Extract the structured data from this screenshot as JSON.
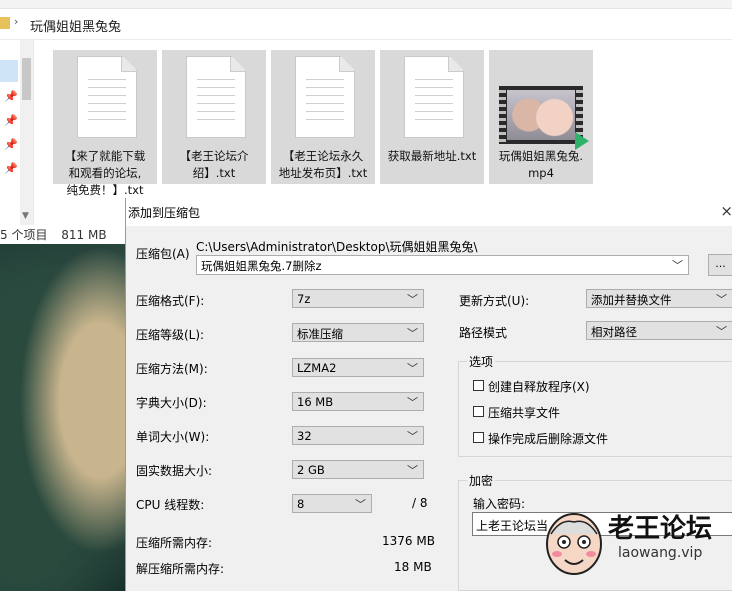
{
  "explorer": {
    "breadcrumb_chevron": "›",
    "current_folder": "玩偶姐姐黑兔兔",
    "status_count": "5 个项目",
    "status_size": "811 MB",
    "files": [
      {
        "name": "【来了就能下载\n和观看的论坛,\n纯免费！】.txt",
        "icon": "text-file-icon"
      },
      {
        "name": "【老王论坛介\n绍】.txt",
        "icon": "text-file-icon"
      },
      {
        "name": "【老王论坛永久\n地址发布页】.txt",
        "icon": "text-file-icon"
      },
      {
        "name": "获取最新地址.txt",
        "icon": "text-file-icon"
      },
      {
        "name": "玩偶姐姐黑兔兔.\nmp4",
        "icon": "video-thumbnail"
      }
    ]
  },
  "dialog": {
    "title": "添加到压缩包",
    "close_glyph": "×",
    "archive_label": "压缩包(A)",
    "archive_dir": "C:\\Users\\Administrator\\Desktop\\玩偶姐姐黑兔兔\\",
    "archive_name": "玩偶姐姐黑兔兔.7删除z",
    "browse_label": "...",
    "format_label": "压缩格式(F):",
    "format_value": "7z",
    "level_label": "压缩等级(L):",
    "level_value": "标准压缩",
    "method_label": "压缩方法(M):",
    "method_value": "LZMA2",
    "dict_label": "字典大小(D):",
    "dict_value": "16 MB",
    "word_label": "单词大小(W):",
    "word_value": "32",
    "solid_label": "固实数据大小:",
    "solid_value": "2 GB",
    "cpu_label": "CPU 线程数:",
    "cpu_value": "8",
    "cpu_max": "/ 8",
    "mem_compress_label": "压缩所需内存:",
    "mem_compress_value": "1376 MB",
    "mem_decompress_label": "解压缩所需内存:",
    "mem_decompress_value": "18 MB",
    "update_label": "更新方式(U):",
    "update_value": "添加并替换文件",
    "pathmode_label": "路径模式",
    "pathmode_value": "相对路径",
    "options_title": "选项",
    "opt_sfx": "创建自释放程序(X)",
    "opt_shared": "压缩共享文件",
    "opt_delete": "操作完成后删除源文件",
    "encrypt_title": "加密",
    "password_label": "输入密码:",
    "password_value": "上老王论坛当"
  },
  "watermark": {
    "text": "老王论坛",
    "url": "laowang.vip"
  },
  "dropdown_glyph": "﹀"
}
